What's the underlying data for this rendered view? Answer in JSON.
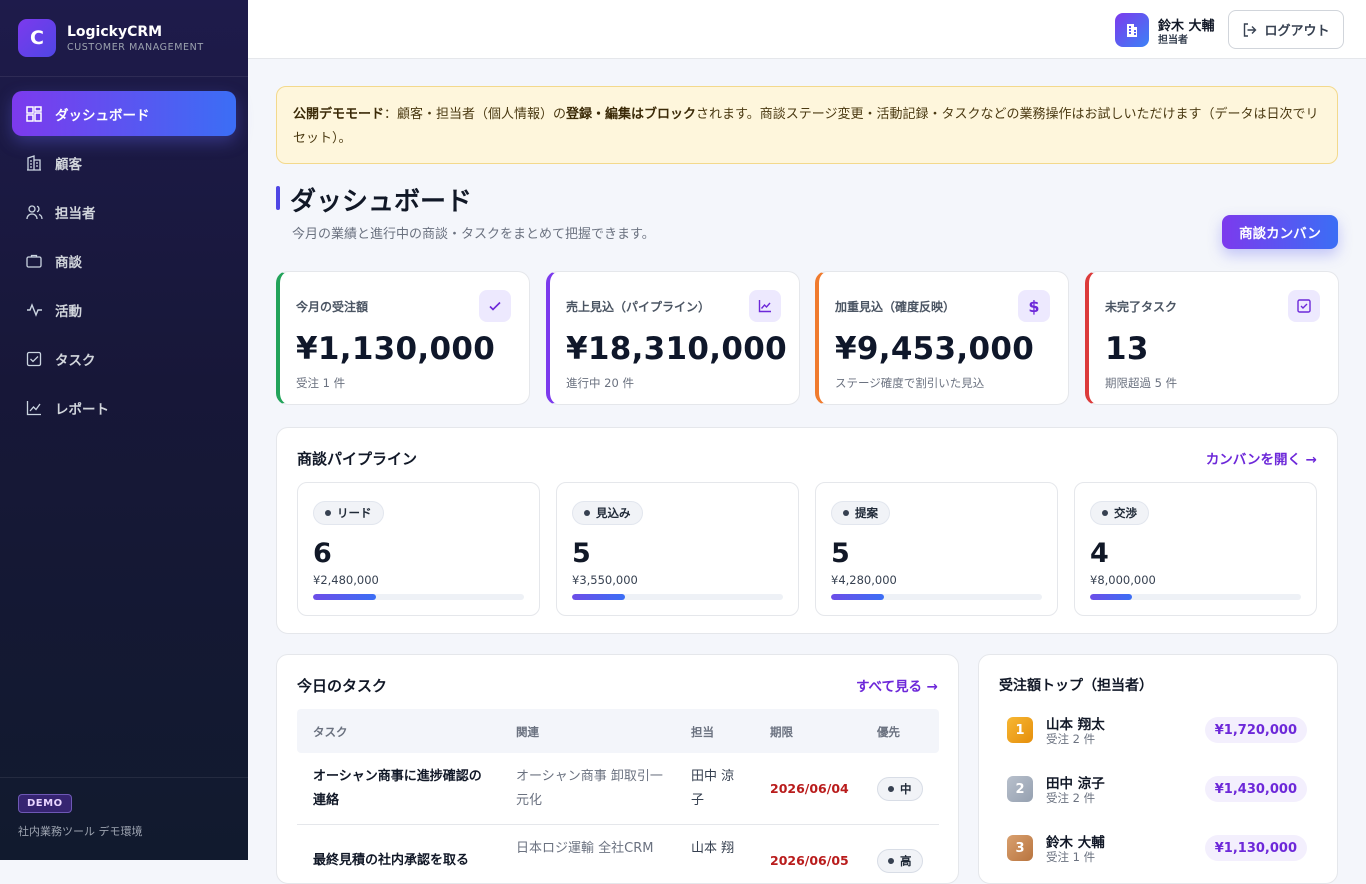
{
  "brand": {
    "name": "LogickyCRM",
    "sub": "CUSTOMER MANAGEMENT",
    "logo_letter": "C"
  },
  "sidebar": {
    "items": [
      {
        "label": "ダッシュボード",
        "icon": "grid-icon",
        "active": true
      },
      {
        "label": "顧客",
        "icon": "building-icon"
      },
      {
        "label": "担当者",
        "icon": "users-icon"
      },
      {
        "label": "商談",
        "icon": "briefcase-icon"
      },
      {
        "label": "活動",
        "icon": "activity-icon"
      },
      {
        "label": "タスク",
        "icon": "check-square-icon"
      },
      {
        "label": "レポート",
        "icon": "chart-icon"
      }
    ],
    "footer": {
      "badge": "DEMO",
      "note": "社内業務ツール デモ環境"
    }
  },
  "topbar": {
    "user_name": "鈴木 大輔",
    "user_role": "担当者",
    "logout_label": "ログアウト"
  },
  "banner": {
    "lead": "公開デモモード",
    "text1": "：顧客・担当者（個人情報）の",
    "bold": "登録・編集はブロック",
    "text2": "されます。商談ステージ変更・活動記録・タスクなどの業務操作はお試しいただけます（データは日次でリセット）。"
  },
  "page": {
    "title": "ダッシュボード",
    "subtitle": "今月の業績と進行中の商談・タスクをまとめて把握できます。",
    "kanban_button": "商談カンバン"
  },
  "kpis": [
    {
      "label": "今月の受注額",
      "value": "¥1,130,000",
      "sub": "受注 1 件",
      "accent": "#22a35a",
      "icon": "check-icon"
    },
    {
      "label": "売上見込（パイプライン）",
      "value": "¥18,310,000",
      "sub": "進行中 20 件",
      "accent": "#7c3aed",
      "icon": "line-chart-icon"
    },
    {
      "label": "加重見込（確度反映）",
      "value": "¥9,453,000",
      "sub": "ステージ確度で割引いた見込",
      "accent": "#f07b2e",
      "icon": "dollar-icon"
    },
    {
      "label": "未完了タスク",
      "value": "13",
      "sub": "期限超過 5 件",
      "accent": "#dc3b3b",
      "icon": "check-square-icon"
    }
  ],
  "pipeline": {
    "title": "商談パイプライン",
    "link": "カンバンを開く →",
    "stages": [
      {
        "name": "リード",
        "count": "6",
        "amount": "¥2,480,000",
        "progress": 0.3
      },
      {
        "name": "見込み",
        "count": "5",
        "amount": "¥3,550,000",
        "progress": 0.25
      },
      {
        "name": "提案",
        "count": "5",
        "amount": "¥4,280,000",
        "progress": 0.25
      },
      {
        "name": "交渉",
        "count": "4",
        "amount": "¥8,000,000",
        "progress": 0.2
      }
    ]
  },
  "tasks": {
    "title": "今日のタスク",
    "link": "すべて見る →",
    "columns": [
      "タスク",
      "関連",
      "担当",
      "期限",
      "優先"
    ],
    "rows": [
      {
        "task": "オーシャン商事に進捗確認の連絡",
        "related": "オーシャン商事 卸取引一元化",
        "owner": "田中 涼子",
        "due": "2026/06/04",
        "priority": "中"
      },
      {
        "task": "最終見積の社内承認を取る",
        "related": "日本ロジ運輸 全社CRM",
        "owner": "山本 翔",
        "due": "2026/06/05",
        "priority": "高"
      }
    ]
  },
  "ranking": {
    "title": "受注額トップ（担当者）",
    "rows": [
      {
        "rank": "1",
        "name": "山本 翔太",
        "sub": "受注 2 件",
        "amount": "¥1,720,000",
        "color": "#f0a416"
      },
      {
        "rank": "2",
        "name": "田中 涼子",
        "sub": "受注 2 件",
        "amount": "¥1,430,000",
        "color": "#a7b0bf"
      },
      {
        "rank": "3",
        "name": "鈴木 大輔",
        "sub": "受注 1 件",
        "amount": "¥1,130,000",
        "color": "#c98a58"
      }
    ]
  }
}
